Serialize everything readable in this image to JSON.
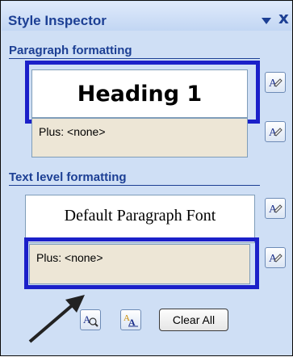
{
  "pane": {
    "title": "Style Inspector",
    "title_icons": [
      "dropdown-triangle-icon",
      "close-x-icon"
    ],
    "close_glyph": "x"
  },
  "paragraph": {
    "heading": "Paragraph formatting",
    "style_name": "Heading 1",
    "plus_text": "Plus: <none>",
    "reset_icon": "reset-style-icon"
  },
  "text_level": {
    "heading": "Text level formatting",
    "style_name": "Default Paragraph Font",
    "plus_text": "Plus: <none>",
    "reset_icon": "reset-style-icon"
  },
  "toolbar": {
    "reveal_icon": "reveal-formatting-icon",
    "new_style_icon": "new-style-icon",
    "clear_all_label": "Clear All"
  },
  "colors": {
    "pane_background": "#cfdff5",
    "heading_text": "#1c3f94",
    "highlight_border": "#1b20c9",
    "formatting_box_fill": "#ede6d6"
  }
}
